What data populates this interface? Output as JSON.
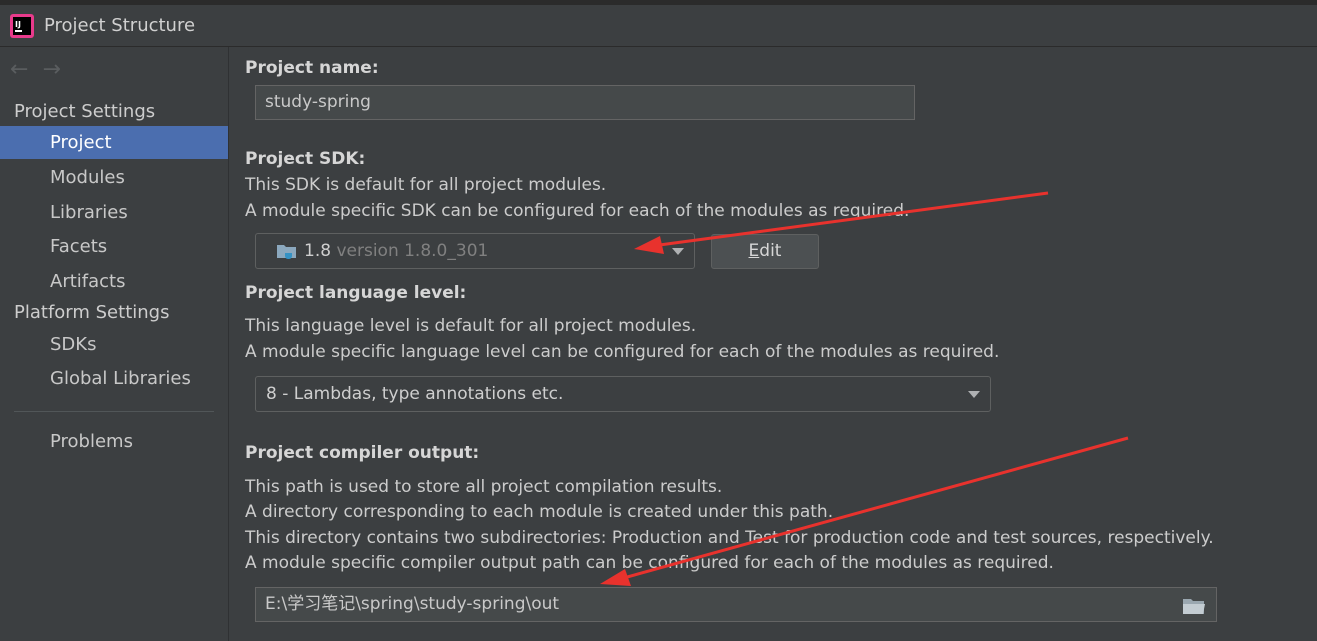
{
  "window": {
    "title": "Project Structure"
  },
  "sidebar": {
    "project_settings_title": "Project Settings",
    "platform_settings_title": "Platform Settings",
    "items": [
      {
        "label": "Project"
      },
      {
        "label": "Modules"
      },
      {
        "label": "Libraries"
      },
      {
        "label": "Facets"
      },
      {
        "label": "Artifacts"
      },
      {
        "label": "SDKs"
      },
      {
        "label": "Global Libraries"
      },
      {
        "label": "Problems"
      }
    ]
  },
  "main": {
    "project_name": {
      "label": "Project name:",
      "value": "study-spring"
    },
    "sdk": {
      "label": "Project SDK:",
      "desc1": "This SDK is default for all project modules.",
      "desc2": "A module specific SDK can be configured for each of the modules as required.",
      "selected_name": "1.8",
      "selected_version": "version 1.8.0_301",
      "edit_prefix": "",
      "edit_mnemonic": "E",
      "edit_rest": "dit"
    },
    "language_level": {
      "label": "Project language level:",
      "desc1": "This language level is default for all project modules.",
      "desc2": "A module specific language level can be configured for each of the modules as required.",
      "selected": "8 - Lambdas, type annotations etc."
    },
    "compiler_output": {
      "label": "Project compiler output:",
      "desc1": "This path is used to store all project compilation results.",
      "desc2": "A directory corresponding to each module is created under this path.",
      "desc3": "This directory contains two subdirectories: Production and Test for production code and test sources, respectively.",
      "desc4": "A module specific compiler output path can be configured for each of the modules as required.",
      "path": "E:\\学习笔记\\spring\\study-spring\\out"
    }
  },
  "colors": {
    "accent": "#4b6eaf",
    "annotation_arrow": "#e8322d"
  },
  "icons": [
    "intellij-icon",
    "back-arrow-icon",
    "forward-arrow-icon",
    "jdk-folder-icon",
    "dropdown-caret-icon",
    "browse-folder-icon"
  ]
}
